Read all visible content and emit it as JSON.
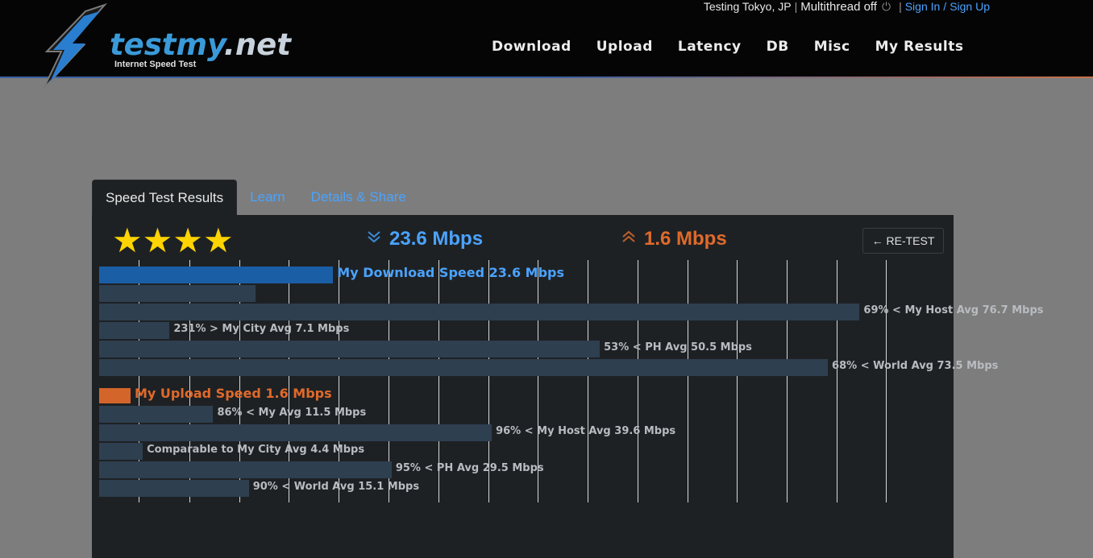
{
  "topbar": {
    "location": "Testing Tokyo, JP",
    "multithread": "Multithread off",
    "power_icon": "power-icon",
    "sign_in": "Sign In",
    "slash": "/",
    "sign_up": "Sign Up"
  },
  "logo": {
    "brand_main": "testmy",
    "brand_suffix": ".net",
    "tagline": "Internet Speed Test",
    "icon": "lightning-bolt-icon"
  },
  "nav": [
    "Download",
    "Upload",
    "Latency",
    "DB",
    "Misc",
    "My Results"
  ],
  "tabs": [
    "Speed Test Results",
    "Learn",
    "Details & Share"
  ],
  "results": {
    "stars": "★★★★",
    "star_rating": 4,
    "download_value": "23.6 Mbps",
    "upload_value": "1.6 Mbps",
    "retest_label": "← RE-TEST",
    "download_color": "#4aa3ff",
    "upload_color": "#e06a2a"
  },
  "chart_data": {
    "type": "bar",
    "orientation": "horizontal",
    "grid": true,
    "xlim": [
      0,
      80
    ],
    "download": [
      {
        "label": "My Download Speed 23.6 Mbps",
        "value": 23.6,
        "main": true
      },
      {
        "label": "",
        "value": 15.8
      },
      {
        "label": "69% < My Host Avg 76.7 Mbps",
        "value": 76.7
      },
      {
        "label": "231% > My City Avg 7.1 Mbps",
        "value": 7.1
      },
      {
        "label": "53% < PH Avg 50.5 Mbps",
        "value": 50.5
      },
      {
        "label": "68% < World Avg 73.5 Mbps",
        "value": 73.5
      }
    ],
    "upload": [
      {
        "label": "My Upload Speed 1.6 Mbps",
        "value": 1.6,
        "main": true
      },
      {
        "label": "86% < My Avg 11.5 Mbps",
        "value": 11.5
      },
      {
        "label": "96% < My Host Avg 39.6 Mbps",
        "value": 39.6
      },
      {
        "label": "Comparable to My City Avg 4.4 Mbps",
        "value": 4.4
      },
      {
        "label": "95% < PH Avg 29.5 Mbps",
        "value": 29.5
      },
      {
        "label": "90% < World Avg 15.1 Mbps",
        "value": 15.1
      }
    ]
  }
}
